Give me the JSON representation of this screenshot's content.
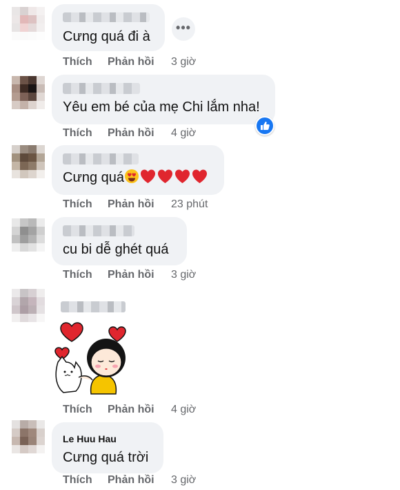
{
  "actions": {
    "like": "Thích",
    "reply": "Phản hồi"
  },
  "more_glyph": "•••",
  "comments": [
    {
      "text": "Cưng quá đi à",
      "time": "3 giờ"
    },
    {
      "text": "Yêu em bé của mẹ Chi lắm nha!",
      "time": "4 giờ",
      "reaction": "like"
    },
    {
      "text": "Cưng quá",
      "time": "23 phút",
      "emoji": [
        "heart-eyes",
        "heart",
        "heart",
        "heart",
        "heart"
      ]
    },
    {
      "text": "cu bi dễ ghét quá",
      "time": "3 giờ"
    },
    {
      "sticker": "girl-hugging-cat-with-hearts",
      "time": "4 giờ"
    },
    {
      "name": "Le Huu Hau",
      "text": "Cưng quá trời",
      "time": "3 giờ"
    }
  ],
  "colors": {
    "bubble": "#f0f2f5",
    "meta": "#65676b",
    "heart": "#e0262e",
    "like_blue": "#1877f2"
  }
}
